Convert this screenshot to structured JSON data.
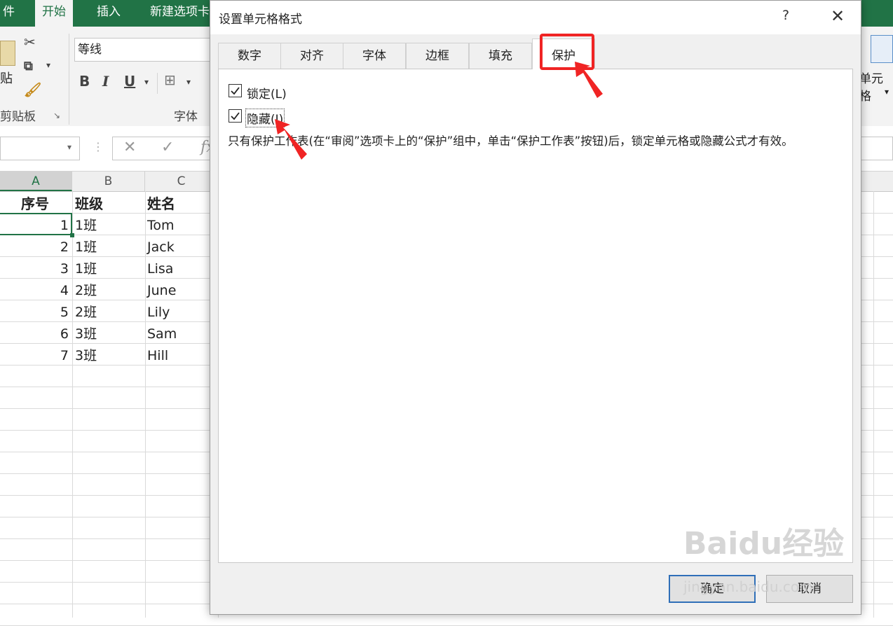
{
  "ribbon": {
    "tabs": [
      "件",
      "开始",
      "插入",
      "新建选项卡"
    ],
    "font_name": "等线",
    "bold": "B",
    "italic": "I",
    "underline": "U",
    "paste_label": "贴",
    "clipboard_group": "剪贴板",
    "font_group": "字体",
    "right_group": "单元格"
  },
  "sheet": {
    "columns": [
      "A",
      "B",
      "C"
    ],
    "header_row": [
      "序号",
      "班级",
      "姓名"
    ],
    "rows": [
      [
        "1",
        "1班",
        "Tom"
      ],
      [
        "2",
        "1班",
        "Jack"
      ],
      [
        "3",
        "1班",
        "Lisa"
      ],
      [
        "4",
        "2班",
        "June"
      ],
      [
        "5",
        "2班",
        "Lily"
      ],
      [
        "6",
        "3班",
        "Sam"
      ],
      [
        "7",
        "3班",
        "Hill"
      ]
    ]
  },
  "dialog": {
    "title": "设置单元格格式",
    "help": "?",
    "close": "✕",
    "tabs": [
      "数字",
      "对齐",
      "字体",
      "边框",
      "填充",
      "保护"
    ],
    "selected_tab": "保护",
    "locked_label": "锁定(L)",
    "locked_checked": true,
    "hidden_label": "隐藏(I)",
    "hidden_checked": true,
    "description": "只有保护工作表(在“审阅”选项卡上的“保护”组中，单击“保护工作表”按钮)后，锁定单元格或隐藏公式才有效。",
    "ok_label": "确定",
    "cancel_label": "取消"
  },
  "watermark": {
    "text": "Baidu经验",
    "url": "jingyan.baidu.com"
  },
  "colors": {
    "excel_green": "#217346",
    "annotation_red": "#f02424",
    "ok_border": "#2f6fb8"
  }
}
